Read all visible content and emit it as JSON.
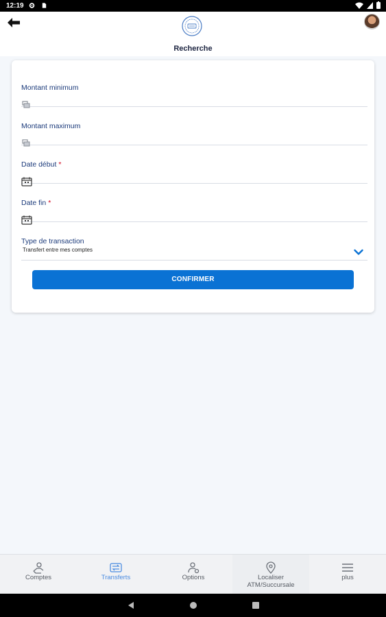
{
  "status_bar": {
    "time": "12:19"
  },
  "header": {
    "title": "Recherche",
    "logo_icon": "bank-seal-icon",
    "avatar": "user-avatar"
  },
  "form": {
    "fields": [
      {
        "label": "Montant minimum",
        "required": false,
        "icon": "money-icon",
        "value": ""
      },
      {
        "label": "Montant maximum",
        "required": false,
        "icon": "money-icon",
        "value": ""
      },
      {
        "label": "Date début",
        "required": true,
        "icon": "calendar-icon",
        "value": ""
      },
      {
        "label": "Date fin",
        "required": true,
        "icon": "calendar-icon",
        "value": ""
      },
      {
        "label": "Type de transaction",
        "required": false,
        "icon": "chevron-down-icon",
        "value": "Transfert entre mes comptes"
      }
    ],
    "required_mark": "*",
    "confirm_label": "CONFIRMER"
  },
  "bottom_nav": {
    "items": [
      {
        "label": "Comptes",
        "icon": "accounts-icon",
        "selected": false
      },
      {
        "label": "Transferts",
        "icon": "transfer-icon",
        "selected": true
      },
      {
        "label": "Options",
        "icon": "options-icon",
        "selected": false
      },
      {
        "label_line1": "Localiser",
        "label_line2": "ATM/Succursale",
        "icon": "location-pin-icon",
        "selected": false
      },
      {
        "label": "plus",
        "icon": "menu-icon",
        "selected": false
      }
    ]
  },
  "colors": {
    "accent": "#0a72d4",
    "label": "#1b3a7a",
    "required": "#d0021b",
    "nav_selected": "#4a8be0"
  }
}
